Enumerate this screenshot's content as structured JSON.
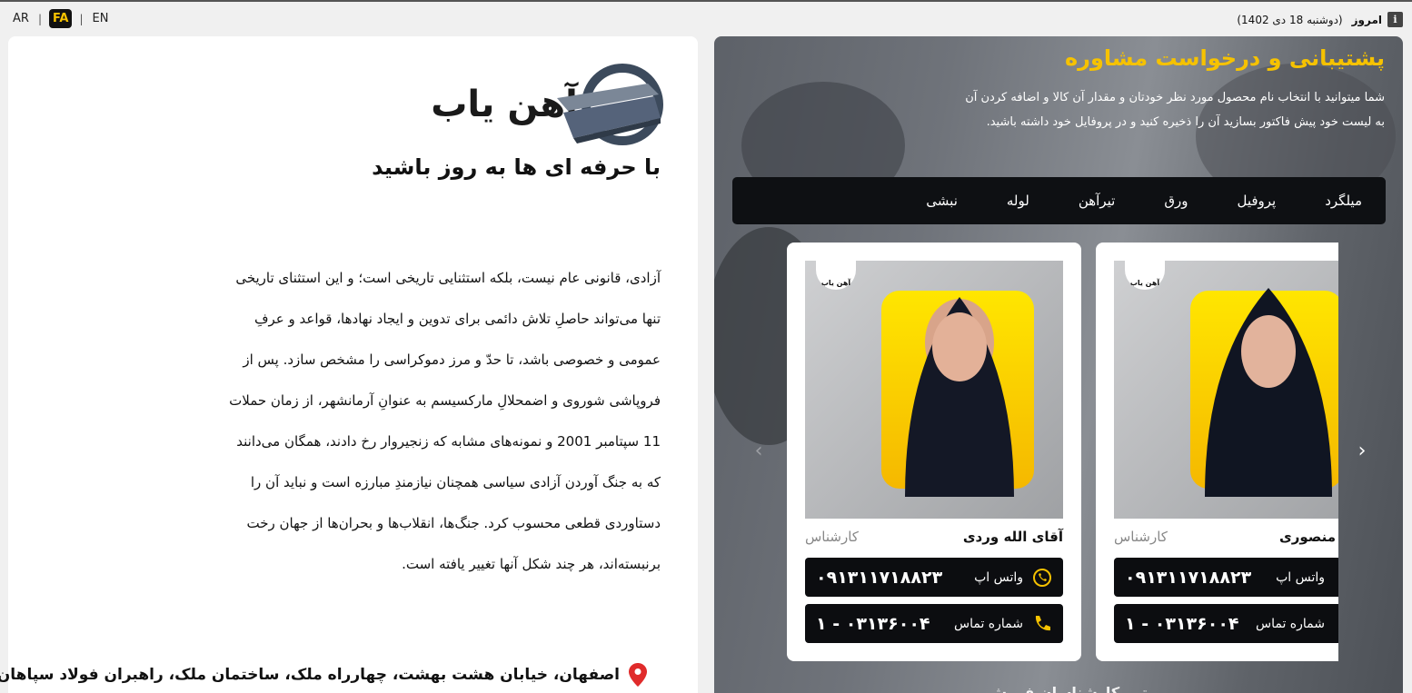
{
  "topbar": {
    "languages": [
      "AR",
      "FA",
      "EN"
    ],
    "today_label": "امروز",
    "date_text": "(دوشنبه 18 دی 1402)",
    "info_icon": "i"
  },
  "left": {
    "logo_text": "آهن یاب",
    "slogan": "با حرفه ای ها به روز باشید",
    "article": [
      "آزادی، قانونی عام نیست، بلکه استثنایی تاریخی است؛ و این استثنای تاریخی",
      "تنها می‌تواند حاصلِ تلاش دائمی برای تدوین و ایجاد نهادها، قواعد و عرفِ",
      "عمومی و خصوصی باشد، تا حدّ و مرز دموکراسی را مشخص سازد. پس از",
      "فروپاشی شوروی و اضمحلالِ مارکسیسم به عنوانِ آرمانشهر، از زمان حملات",
      "11 سپتامبر 2001 و نمونه‌های مشابه که زنجیروار رخ دادند، همگان می‌دانند",
      "که به جنگ آوردن آزادی سیاسی همچنان نیازمندِ مبارزه است و نباید آن را",
      "دستاوردی قطعی محسوب کرد. جنگ‌ها، انقلاب‌ها و بحران‌ها از جهان رخت",
      "برنبسته‌اند، هر چند شکل آنها تغییر یافته است."
    ],
    "address": "اصفهان، خیابان هشت بهشت، چهارراه ملک، ساختمان ملک، راهبران فولاد سپاهان ("
  },
  "right": {
    "title": "پشتیبانی و درخواست مشاوره",
    "description": "شما میتوانید با انتخاب نام محصول مورد نظر خودتان و مقدار آن کالا و اضافه کردن آن به لیست خود پیش فاکتور بسازید آن را ذخیره کنید و در پروفایل خود داشته باشید.",
    "categories": [
      "میلگرد",
      "پروفیل",
      "ورق",
      "تیرآهن",
      "لوله",
      "نبشی"
    ],
    "cards": [
      {
        "name": "منصوری",
        "role": "کارشناس",
        "whatsapp_label": "واتس اپ",
        "whatsapp_number": "۰۹۱۳۱۱۷۱۸۸۲۳",
        "phone_label": "شماره تماس",
        "phone_number": "۰۳۱۳۶۰۰۴ - ۱",
        "card_logo": "آهن یاب"
      },
      {
        "name": "آقای الله وردی",
        "role": "کارشناس",
        "whatsapp_label": "واتس اپ",
        "whatsapp_number": "۰۹۱۳۱۱۷۱۸۸۲۳",
        "phone_label": "شماره تماس",
        "phone_number": "۰۳۱۳۶۰۰۴ - ۱",
        "card_logo": "آهن یاب"
      }
    ],
    "bottom_peek": "تیم کارشناسان فروش"
  },
  "colors": {
    "accent": "#f6c200",
    "dark": "#0c0d10",
    "whatsapp": "#f6c200"
  }
}
